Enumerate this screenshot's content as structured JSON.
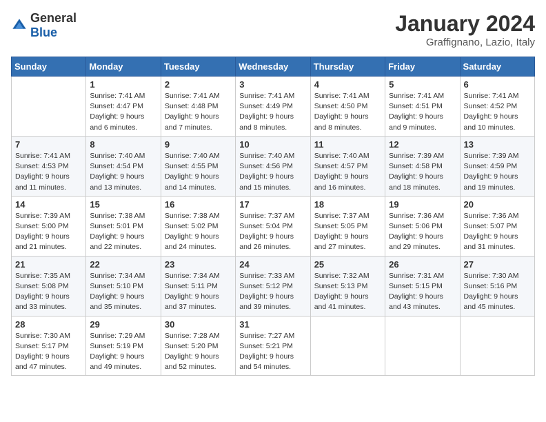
{
  "header": {
    "logo": {
      "general": "General",
      "blue": "Blue"
    },
    "month": "January 2024",
    "location": "Graffignano, Lazio, Italy"
  },
  "weekdays": [
    "Sunday",
    "Monday",
    "Tuesday",
    "Wednesday",
    "Thursday",
    "Friday",
    "Saturday"
  ],
  "weeks": [
    [
      {
        "day": "",
        "info": ""
      },
      {
        "day": "1",
        "info": "Sunrise: 7:41 AM\nSunset: 4:47 PM\nDaylight: 9 hours\nand 6 minutes."
      },
      {
        "day": "2",
        "info": "Sunrise: 7:41 AM\nSunset: 4:48 PM\nDaylight: 9 hours\nand 7 minutes."
      },
      {
        "day": "3",
        "info": "Sunrise: 7:41 AM\nSunset: 4:49 PM\nDaylight: 9 hours\nand 8 minutes."
      },
      {
        "day": "4",
        "info": "Sunrise: 7:41 AM\nSunset: 4:50 PM\nDaylight: 9 hours\nand 8 minutes."
      },
      {
        "day": "5",
        "info": "Sunrise: 7:41 AM\nSunset: 4:51 PM\nDaylight: 9 hours\nand 9 minutes."
      },
      {
        "day": "6",
        "info": "Sunrise: 7:41 AM\nSunset: 4:52 PM\nDaylight: 9 hours\nand 10 minutes."
      }
    ],
    [
      {
        "day": "7",
        "info": "Sunrise: 7:41 AM\nSunset: 4:53 PM\nDaylight: 9 hours\nand 11 minutes."
      },
      {
        "day": "8",
        "info": "Sunrise: 7:40 AM\nSunset: 4:54 PM\nDaylight: 9 hours\nand 13 minutes."
      },
      {
        "day": "9",
        "info": "Sunrise: 7:40 AM\nSunset: 4:55 PM\nDaylight: 9 hours\nand 14 minutes."
      },
      {
        "day": "10",
        "info": "Sunrise: 7:40 AM\nSunset: 4:56 PM\nDaylight: 9 hours\nand 15 minutes."
      },
      {
        "day": "11",
        "info": "Sunrise: 7:40 AM\nSunset: 4:57 PM\nDaylight: 9 hours\nand 16 minutes."
      },
      {
        "day": "12",
        "info": "Sunrise: 7:39 AM\nSunset: 4:58 PM\nDaylight: 9 hours\nand 18 minutes."
      },
      {
        "day": "13",
        "info": "Sunrise: 7:39 AM\nSunset: 4:59 PM\nDaylight: 9 hours\nand 19 minutes."
      }
    ],
    [
      {
        "day": "14",
        "info": "Sunrise: 7:39 AM\nSunset: 5:00 PM\nDaylight: 9 hours\nand 21 minutes."
      },
      {
        "day": "15",
        "info": "Sunrise: 7:38 AM\nSunset: 5:01 PM\nDaylight: 9 hours\nand 22 minutes."
      },
      {
        "day": "16",
        "info": "Sunrise: 7:38 AM\nSunset: 5:02 PM\nDaylight: 9 hours\nand 24 minutes."
      },
      {
        "day": "17",
        "info": "Sunrise: 7:37 AM\nSunset: 5:04 PM\nDaylight: 9 hours\nand 26 minutes."
      },
      {
        "day": "18",
        "info": "Sunrise: 7:37 AM\nSunset: 5:05 PM\nDaylight: 9 hours\nand 27 minutes."
      },
      {
        "day": "19",
        "info": "Sunrise: 7:36 AM\nSunset: 5:06 PM\nDaylight: 9 hours\nand 29 minutes."
      },
      {
        "day": "20",
        "info": "Sunrise: 7:36 AM\nSunset: 5:07 PM\nDaylight: 9 hours\nand 31 minutes."
      }
    ],
    [
      {
        "day": "21",
        "info": "Sunrise: 7:35 AM\nSunset: 5:08 PM\nDaylight: 9 hours\nand 33 minutes."
      },
      {
        "day": "22",
        "info": "Sunrise: 7:34 AM\nSunset: 5:10 PM\nDaylight: 9 hours\nand 35 minutes."
      },
      {
        "day": "23",
        "info": "Sunrise: 7:34 AM\nSunset: 5:11 PM\nDaylight: 9 hours\nand 37 minutes."
      },
      {
        "day": "24",
        "info": "Sunrise: 7:33 AM\nSunset: 5:12 PM\nDaylight: 9 hours\nand 39 minutes."
      },
      {
        "day": "25",
        "info": "Sunrise: 7:32 AM\nSunset: 5:13 PM\nDaylight: 9 hours\nand 41 minutes."
      },
      {
        "day": "26",
        "info": "Sunrise: 7:31 AM\nSunset: 5:15 PM\nDaylight: 9 hours\nand 43 minutes."
      },
      {
        "day": "27",
        "info": "Sunrise: 7:30 AM\nSunset: 5:16 PM\nDaylight: 9 hours\nand 45 minutes."
      }
    ],
    [
      {
        "day": "28",
        "info": "Sunrise: 7:30 AM\nSunset: 5:17 PM\nDaylight: 9 hours\nand 47 minutes."
      },
      {
        "day": "29",
        "info": "Sunrise: 7:29 AM\nSunset: 5:19 PM\nDaylight: 9 hours\nand 49 minutes."
      },
      {
        "day": "30",
        "info": "Sunrise: 7:28 AM\nSunset: 5:20 PM\nDaylight: 9 hours\nand 52 minutes."
      },
      {
        "day": "31",
        "info": "Sunrise: 7:27 AM\nSunset: 5:21 PM\nDaylight: 9 hours\nand 54 minutes."
      },
      {
        "day": "",
        "info": ""
      },
      {
        "day": "",
        "info": ""
      },
      {
        "day": "",
        "info": ""
      }
    ]
  ]
}
